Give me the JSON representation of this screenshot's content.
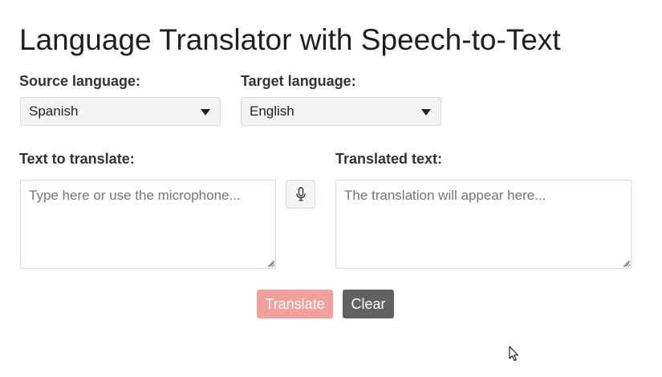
{
  "title": "Language Translator with Speech-to-Text",
  "source": {
    "label": "Source language:",
    "selected": "Spanish"
  },
  "target": {
    "label": "Target language:",
    "selected": "English"
  },
  "input": {
    "label": "Text to translate:",
    "value": "",
    "placeholder": "Type here or use the microphone..."
  },
  "output": {
    "label": "Translated text:",
    "value": "",
    "placeholder": "The translation will appear here..."
  },
  "actions": {
    "translate_label": "Translate",
    "clear_label": "Clear"
  },
  "icons": {
    "mic": "microphone-icon",
    "caret": "caret-down-icon",
    "cursor": "mouse-pointer-icon"
  },
  "colors": {
    "translate_button": "#f2a09c",
    "clear_button": "#616161"
  }
}
